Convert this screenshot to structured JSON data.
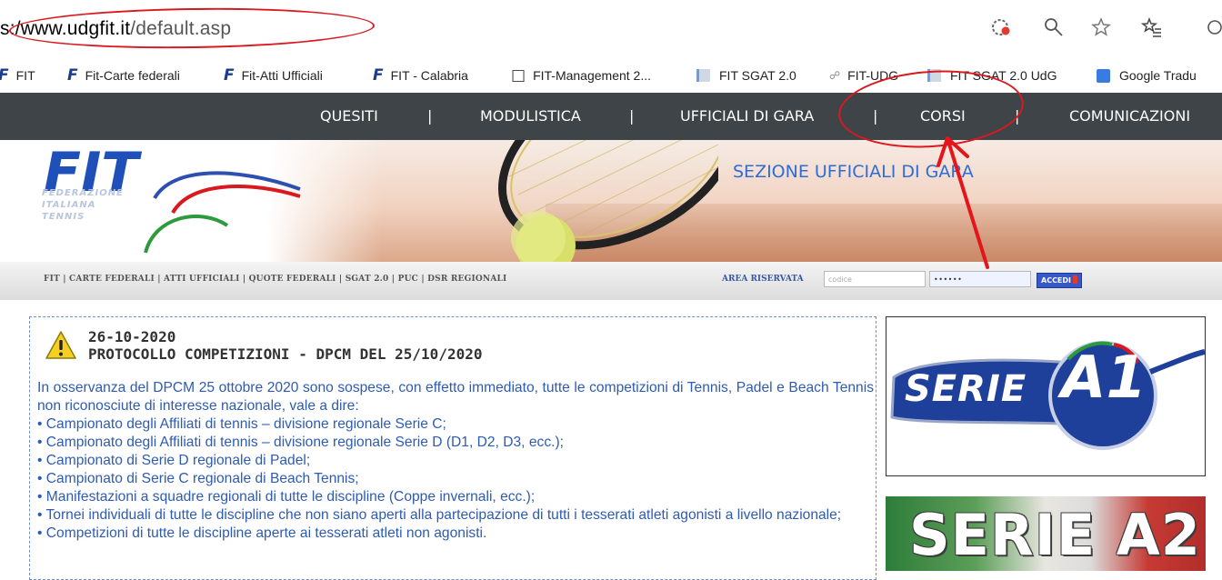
{
  "browser": {
    "url_prefix": "s:/",
    "url_host": "www.udgfit.it",
    "url_path": "/default.asp",
    "icons": [
      "extension-icon",
      "zoom-icon",
      "favorite-star-icon",
      "favorites-list-icon"
    ]
  },
  "bookmarks": [
    {
      "icon": "fit-f-icon",
      "label": "FIT"
    },
    {
      "icon": "fit-f-icon",
      "label": "Fit-Carte federali"
    },
    {
      "icon": "fit-f-icon",
      "label": "Fit-Atti Ufficiali"
    },
    {
      "icon": "fit-f-icon",
      "label": "FIT - Calabria"
    },
    {
      "icon": "document-icon",
      "label": "FIT-Management 2..."
    },
    {
      "icon": "sgat-icon",
      "label": "FIT SGAT 2.0"
    },
    {
      "icon": "udg-icon",
      "label": "FIT-UDG"
    },
    {
      "icon": "sgat-icon",
      "label": "FIT SGAT 2.0 UdG"
    },
    {
      "icon": "translate-icon",
      "label": "Google Tradu"
    }
  ],
  "nav": {
    "items": [
      "QUESITI",
      "MODULISTICA",
      "UFFICIALI DI GARA",
      "CORSI",
      "COMUNICAZIONI"
    ],
    "separator": "|"
  },
  "banner": {
    "logo": "FIT",
    "logo_sub": [
      "FEDERAZIONE",
      "ITALIANA",
      "TENNIS"
    ],
    "title": "SEZIONE UFFICIALI DI GARA"
  },
  "subnav": {
    "links": "FIT | CARTE FEDERALI | ATTI UFFICIALI | QUOTE FEDERALI | SGAT 2.0 | PUC | DSR REGIONALI",
    "area_label": "AREA RISERVATA",
    "code_placeholder": "codice",
    "password_value": "••••••",
    "login_button": "ACCEDI"
  },
  "news": {
    "date": "26-10-2020",
    "title": "PROTOCOLLO COMPETIZIONI - DPCM DEL 25/10/2020",
    "intro": "In osservanza del DPCM 25 ottobre 2020 sono sospese, con effetto immediato, tutte le competizioni di Tennis, Padel e Beach Tennis non riconosciute di interesse nazionale, vale a dire:",
    "items": [
      "Campionato degli Affiliati di tennis – divisione regionale Serie C;",
      "Campionato degli Affiliati di tennis – divisione regionale Serie D (D1, D2, D3, ecc.);",
      "Campionato di Serie D regionale di Padel;",
      "Campionato di Serie C regionale di Beach Tennis;",
      "Manifestazioni a squadre regionali di tutte le discipline (Coppe invernali, ecc.);",
      "Tornei individuali di tutte le discipline che non siano aperti alla partecipazione di tutti i tesserati atleti agonisti a livello nazionale;",
      "Competizioni di tutte le discipline aperte ai tesserati atleti non agonisti."
    ]
  },
  "ads": {
    "a1_text": "SERIE",
    "a1_num": "A1",
    "a2_text": "SERIE A2"
  },
  "colors": {
    "nav_bg": "#3f4448",
    "link_blue": "#2d5bb3",
    "annotation_red": "#d9191f"
  }
}
